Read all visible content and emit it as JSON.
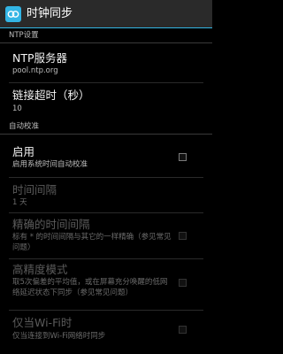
{
  "app": {
    "title": "时钟同步",
    "icon": "clock-sync-icon",
    "accent": "#33b5e5"
  },
  "sections": {
    "ntp_header": "NTP设置",
    "auto_header": "自动校准"
  },
  "prefs": {
    "ntp_server": {
      "title": "NTP服务器",
      "summary": "pool.ntp.org"
    },
    "timeout": {
      "title": "链接超时（秒）",
      "summary": "10"
    },
    "enable": {
      "title": "启用",
      "summary": "启用系统时间自动校准",
      "checked": false
    },
    "interval": {
      "title": "时间间隔",
      "summary": "1 天"
    },
    "precise_interval": {
      "title": "精确的时间间隔",
      "summary": "标有 * 的时间间隔与其它的一样精确（参见常见问题）",
      "checked": false
    },
    "high_precision": {
      "title": "高精度模式",
      "summary": "取5次偏差的平均值，或在屏幕充分唤醒的低网络延迟状态下同步（参见常见问题）",
      "checked": false
    },
    "wifi_only": {
      "title": "仅当Wi-Fi时",
      "summary": "仅当连接到Wi-Fi网络时同步",
      "checked": false
    }
  }
}
